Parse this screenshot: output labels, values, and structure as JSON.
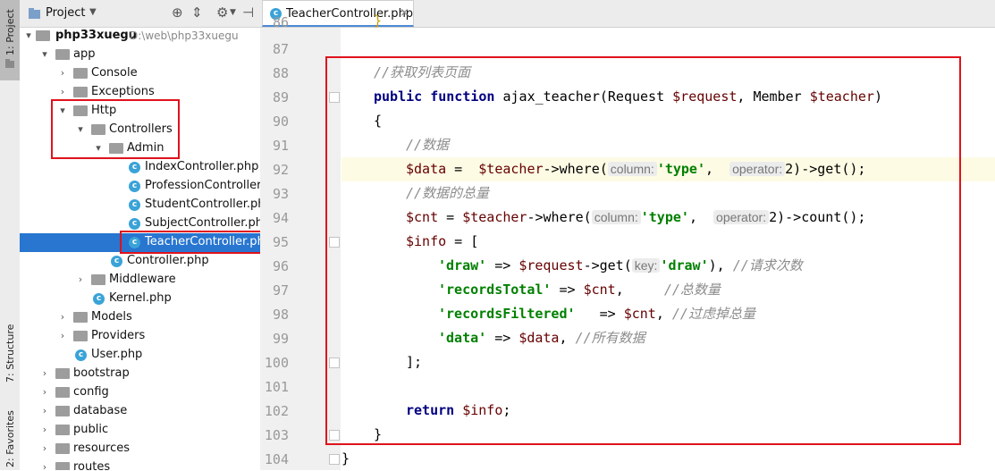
{
  "tool_strip": {
    "project_tab": "1: Project",
    "structure_tab": "7: Structure",
    "favorites_tab": "2: Favorites"
  },
  "project_panel": {
    "title": "Project",
    "tree": [
      {
        "label": "php33xuegu",
        "path": "D:\\web\\php33xuegu",
        "bold": true
      },
      {
        "label": "app"
      },
      {
        "label": "Console"
      },
      {
        "label": "Exceptions"
      },
      {
        "label": "Http"
      },
      {
        "label": "Controllers"
      },
      {
        "label": "Admin"
      },
      {
        "label": "IndexController.php"
      },
      {
        "label": "ProfessionController.php"
      },
      {
        "label": "StudentController.php"
      },
      {
        "label": "SubjectController.php"
      },
      {
        "label": "TeacherController.php",
        "selected": true
      },
      {
        "label": "Controller.php"
      },
      {
        "label": "Middleware"
      },
      {
        "label": "Kernel.php"
      },
      {
        "label": "Models"
      },
      {
        "label": "Providers"
      },
      {
        "label": "User.php"
      },
      {
        "label": "bootstrap"
      },
      {
        "label": "config"
      },
      {
        "label": "database"
      },
      {
        "label": "public"
      },
      {
        "label": "resources"
      },
      {
        "label": "routes"
      }
    ]
  },
  "editor": {
    "tab_label": "TeacherController.php",
    "line_numbers": [
      "86",
      "87",
      "88",
      "89",
      "90",
      "91",
      "92",
      "93",
      "94",
      "95",
      "96",
      "97",
      "98",
      "99",
      "100",
      "101",
      "102",
      "103",
      "104"
    ],
    "code": {
      "l86": "}",
      "l88_comment": "//获取列表页面",
      "l89_public": "public",
      "l89_function": "function",
      "l89_name": " ajax_teacher(Request ",
      "l89_var1": "$request",
      "l89_mid": ", Member ",
      "l89_var2": "$teacher",
      "l89_end": ")",
      "l90": "{",
      "l91_comment": "//数据",
      "l92_var": "$data",
      "l92_eq": " =  ",
      "l92_obj": "$teacher",
      "l92_call": "->where(",
      "l92_hint1": "column:",
      "l92_str": "'type'",
      "l92_comma": ",  ",
      "l92_hint2": "operator:",
      "l92_tail": "2)->get();",
      "l93_comment": "//数据的总量",
      "l94_var": "$cnt",
      "l94_eq": " = ",
      "l94_obj": "$teacher",
      "l94_call": "->where(",
      "l94_hint1": "column:",
      "l94_str": "'type'",
      "l94_comma": ",  ",
      "l94_hint2": "operator:",
      "l94_tail": "2)->count();",
      "l95_var": "$info",
      "l95_rest": " = [",
      "l96_key": "'draw'",
      "l96_arrow": " => ",
      "l96_var": "$request",
      "l96_call": "->get(",
      "l96_hint": "key:",
      "l96_str": "'draw'",
      "l96_close": "), ",
      "l96_comment": "//请求次数",
      "l97_key": "'recordsTotal'",
      "l97_arrow": " => ",
      "l97_var": "$cnt",
      "l97_sep": ",     ",
      "l97_comment": "//总数量",
      "l98_key": "'recordsFiltered'",
      "l98_arrow": "   => ",
      "l98_var": "$cnt",
      "l98_sep": ", ",
      "l98_comment": "//过虑掉总量",
      "l99_key": "'data'",
      "l99_arrow": " => ",
      "l99_var": "$data",
      "l99_sep": ", ",
      "l99_comment": "//所有数据",
      "l100": "];",
      "l102_kw": "return",
      "l102_sp": " ",
      "l102_var": "$info",
      "l102_end": ";",
      "l103": "}",
      "l104": "}"
    }
  },
  "colors": {
    "selection": "#2876d0",
    "highlight_box": "#e0121c",
    "keyword": "#000080",
    "variable": "#660000",
    "string": "#008000",
    "comment": "#8c8c8c"
  }
}
